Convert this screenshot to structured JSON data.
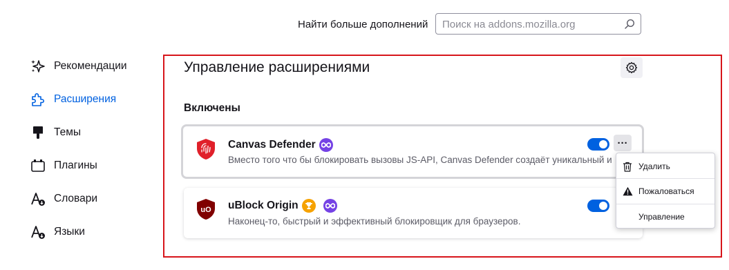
{
  "header": {
    "find_more_label": "Найти больше дополнений",
    "search_placeholder": "Поиск на addons.mozilla.org"
  },
  "sidebar": {
    "items": [
      {
        "label": "Рекомендации",
        "icon": "sparkle-icon"
      },
      {
        "label": "Расширения",
        "icon": "puzzle-icon",
        "selected": true
      },
      {
        "label": "Темы",
        "icon": "brush-icon"
      },
      {
        "label": "Плагины",
        "icon": "plugin-icon"
      },
      {
        "label": "Словари",
        "icon": "dictionary-icon"
      },
      {
        "label": "Языки",
        "icon": "language-icon"
      }
    ]
  },
  "main": {
    "title": "Управление расширениями",
    "section_title": "Включены",
    "addons": [
      {
        "name": "Canvas Defender",
        "description": "Вместо того что бы блокировать вызовы JS-API, Canvas Defender создаёт уникальный и",
        "badges": [
          "recommended-badge"
        ],
        "enabled": true
      },
      {
        "name": "uBlock Origin",
        "description": "Наконец-то, быстрый и эффективный блокировщик для браузеров.",
        "badges": [
          "trophy-badge",
          "recommended-badge"
        ],
        "enabled": true
      }
    ],
    "more_button_label": "···"
  },
  "context_menu": {
    "items": [
      {
        "label": "Удалить",
        "icon": "trash-icon"
      },
      {
        "label": "Пожаловаться",
        "icon": "warning-icon"
      },
      {
        "label": "Управление",
        "icon": ""
      }
    ]
  },
  "colors": {
    "accent": "#0061e0",
    "highlight_frame": "#d7141a",
    "recommended_badge": "#7542e5",
    "trophy_badge": "#f6a200"
  }
}
